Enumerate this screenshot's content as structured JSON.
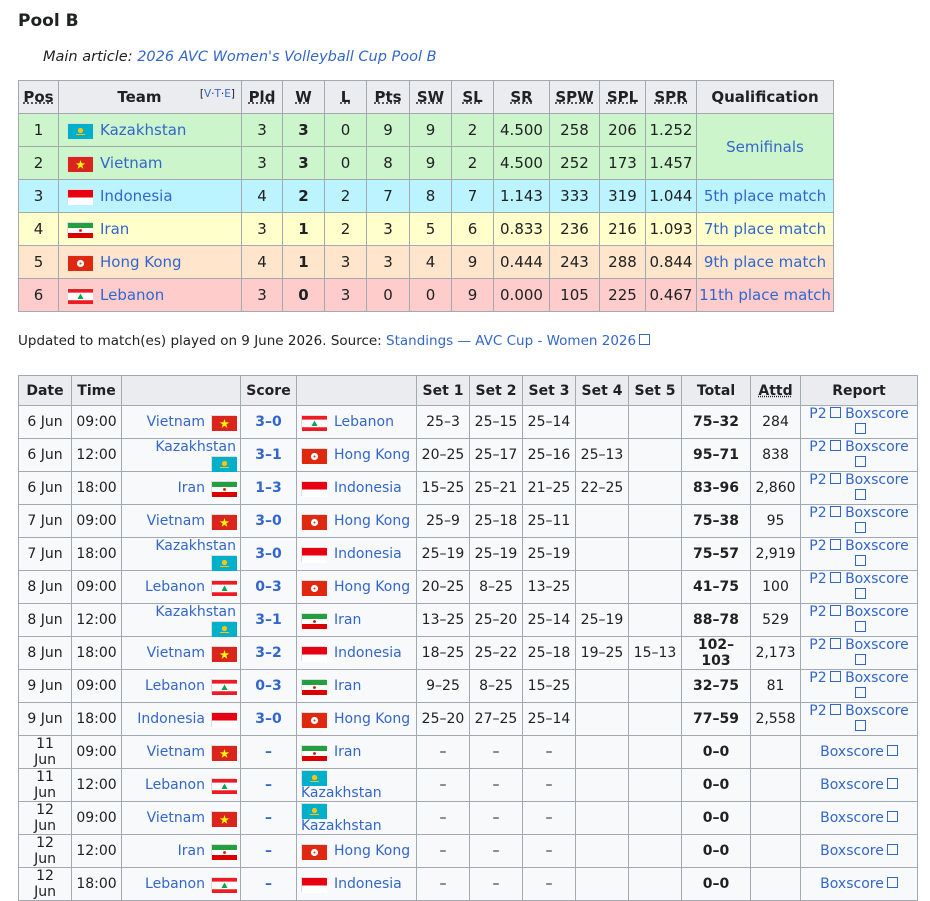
{
  "heading": "Pool B",
  "hatnote": {
    "prefix": "Main article: ",
    "link": "2026 AVC Women's Volleyball Cup Pool B"
  },
  "standings": {
    "headers": {
      "pos": "Pos",
      "team": "Team",
      "pld": "Pld",
      "w": "W",
      "l": "L",
      "pts": "Pts",
      "sw": "SW",
      "sl": "SL",
      "sr": "SR",
      "spw": "SPW",
      "spl": "SPL",
      "spr": "SPR",
      "qual": "Qualification"
    },
    "vte": {
      "v": "V",
      "t": "T",
      "e": "E"
    },
    "rows": [
      {
        "pos": "1",
        "team": "Kazakhstan",
        "flag": "kazakhstan-flag",
        "pld": "3",
        "w": "3",
        "l": "0",
        "pts": "9",
        "sw": "9",
        "sl": "2",
        "sr": "4.500",
        "spw": "258",
        "spl": "206",
        "spr": "1.252"
      },
      {
        "pos": "2",
        "team": "Vietnam",
        "flag": "vietnam-flag",
        "pld": "3",
        "w": "3",
        "l": "0",
        "pts": "8",
        "sw": "9",
        "sl": "2",
        "sr": "4.500",
        "spw": "252",
        "spl": "173",
        "spr": "1.457"
      },
      {
        "pos": "3",
        "team": "Indonesia",
        "flag": "indonesia-flag",
        "pld": "4",
        "w": "2",
        "l": "2",
        "pts": "7",
        "sw": "8",
        "sl": "7",
        "sr": "1.143",
        "spw": "333",
        "spl": "319",
        "spr": "1.044"
      },
      {
        "pos": "4",
        "team": "Iran",
        "flag": "iran-flag",
        "pld": "3",
        "w": "1",
        "l": "2",
        "pts": "3",
        "sw": "5",
        "sl": "6",
        "sr": "0.833",
        "spw": "236",
        "spl": "216",
        "spr": "1.093"
      },
      {
        "pos": "5",
        "team": "Hong Kong",
        "flag": "hong-kong-flag",
        "pld": "4",
        "w": "1",
        "l": "3",
        "pts": "3",
        "sw": "4",
        "sl": "9",
        "sr": "0.444",
        "spw": "243",
        "spl": "288",
        "spr": "0.844"
      },
      {
        "pos": "6",
        "team": "Lebanon",
        "flag": "lebanon-flag",
        "pld": "3",
        "w": "0",
        "l": "3",
        "pts": "0",
        "sw": "0",
        "sl": "9",
        "sr": "0.000",
        "spw": "105",
        "spl": "225",
        "spr": "0.467"
      }
    ],
    "qualification": [
      "Semifinals",
      "5th place match",
      "7th place match",
      "9th place match",
      "11th place match"
    ],
    "row_colors": [
      "#ccf5cc",
      "#bbf3ff",
      "#ffffcc",
      "#ffe5cc",
      "#ffcccc"
    ]
  },
  "updated": {
    "text": "Updated to match(es) played on 9 June 2026. Source: ",
    "source_link": "Standings — AVC Cup - Women 2026"
  },
  "matches": {
    "headers": {
      "date": "Date",
      "time": "Time",
      "score": "Score",
      "set1": "Set 1",
      "set2": "Set 2",
      "set3": "Set 3",
      "set4": "Set 4",
      "set5": "Set 5",
      "total": "Total",
      "attd": "Attd",
      "report": "Report"
    },
    "rows": [
      {
        "date": "6 Jun",
        "time": "09:00",
        "home": "Vietnam",
        "home_flag": "vietnam-flag",
        "score": "3–0",
        "away": "Lebanon",
        "away_flag": "lebanon-flag",
        "s1": "25–3",
        "s2": "25–15",
        "s3": "25–14",
        "s4": "",
        "s5": "",
        "total": "75–32",
        "attd": "284",
        "p2": "P2",
        "box": "Boxscore"
      },
      {
        "date": "6 Jun",
        "time": "12:00",
        "home": "Kazakhstan",
        "home_flag": "kazakhstan-flag",
        "score": "3–1",
        "away": "Hong Kong",
        "away_flag": "hong-kong-flag",
        "s1": "20–25",
        "s2": "25–17",
        "s3": "25–16",
        "s4": "25–13",
        "s5": "",
        "total": "95–71",
        "attd": "838",
        "p2": "P2",
        "box": "Boxscore"
      },
      {
        "date": "6 Jun",
        "time": "18:00",
        "home": "Iran",
        "home_flag": "iran-flag",
        "score": "1–3",
        "away": "Indonesia",
        "away_flag": "indonesia-flag",
        "s1": "15–25",
        "s2": "25–21",
        "s3": "21–25",
        "s4": "22–25",
        "s5": "",
        "total": "83–96",
        "attd": "2,860",
        "p2": "P2",
        "box": "Boxscore"
      },
      {
        "date": "7 Jun",
        "time": "09:00",
        "home": "Vietnam",
        "home_flag": "vietnam-flag",
        "score": "3–0",
        "away": "Hong Kong",
        "away_flag": "hong-kong-flag",
        "s1": "25–9",
        "s2": "25–18",
        "s3": "25–11",
        "s4": "",
        "s5": "",
        "total": "75–38",
        "attd": "95",
        "p2": "P2",
        "box": "Boxscore"
      },
      {
        "date": "7 Jun",
        "time": "18:00",
        "home": "Kazakhstan",
        "home_flag": "kazakhstan-flag",
        "score": "3–0",
        "away": "Indonesia",
        "away_flag": "indonesia-flag",
        "s1": "25–19",
        "s2": "25–19",
        "s3": "25–19",
        "s4": "",
        "s5": "",
        "total": "75–57",
        "attd": "2,919",
        "p2": "P2",
        "box": "Boxscore"
      },
      {
        "date": "8 Jun",
        "time": "09:00",
        "home": "Lebanon",
        "home_flag": "lebanon-flag",
        "score": "0–3",
        "away": "Hong Kong",
        "away_flag": "hong-kong-flag",
        "s1": "20–25",
        "s2": "8–25",
        "s3": "13–25",
        "s4": "",
        "s5": "",
        "total": "41–75",
        "attd": "100",
        "p2": "P2",
        "box": "Boxscore"
      },
      {
        "date": "8 Jun",
        "time": "12:00",
        "home": "Kazakhstan",
        "home_flag": "kazakhstan-flag",
        "score": "3–1",
        "away": "Iran",
        "away_flag": "iran-flag",
        "s1": "13–25",
        "s2": "25–20",
        "s3": "25–14",
        "s4": "25–19",
        "s5": "",
        "total": "88–78",
        "attd": "529",
        "p2": "P2",
        "box": "Boxscore"
      },
      {
        "date": "8 Jun",
        "time": "18:00",
        "home": "Vietnam",
        "home_flag": "vietnam-flag",
        "score": "3–2",
        "away": "Indonesia",
        "away_flag": "indonesia-flag",
        "s1": "18–25",
        "s2": "25–22",
        "s3": "25–18",
        "s4": "19–25",
        "s5": "15–13",
        "total": "102–103",
        "attd": "2,173",
        "p2": "P2",
        "box": "Boxscore"
      },
      {
        "date": "9 Jun",
        "time": "09:00",
        "home": "Lebanon",
        "home_flag": "lebanon-flag",
        "score": "0–3",
        "away": "Iran",
        "away_flag": "iran-flag",
        "s1": "9–25",
        "s2": "8–25",
        "s3": "15–25",
        "s4": "",
        "s5": "",
        "total": "32–75",
        "attd": "81",
        "p2": "P2",
        "box": "Boxscore"
      },
      {
        "date": "9 Jun",
        "time": "18:00",
        "home": "Indonesia",
        "home_flag": "indonesia-flag",
        "score": "3–0",
        "away": "Hong Kong",
        "away_flag": "hong-kong-flag",
        "s1": "25–20",
        "s2": "27–25",
        "s3": "25–14",
        "s4": "",
        "s5": "",
        "total": "77–59",
        "attd": "2,558",
        "p2": "P2",
        "box": "Boxscore"
      },
      {
        "date": "11 Jun",
        "time": "09:00",
        "home": "Vietnam",
        "home_flag": "vietnam-flag",
        "score": "–",
        "away": "Iran",
        "away_flag": "iran-flag",
        "s1": "–",
        "s2": "–",
        "s3": "–",
        "s4": "",
        "s5": "",
        "total": "0–0",
        "attd": "",
        "p2": "",
        "box": "Boxscore"
      },
      {
        "date": "11 Jun",
        "time": "12:00",
        "home": "Lebanon",
        "home_flag": "lebanon-flag",
        "score": "–",
        "away": "Kazakhstan",
        "away_flag": "kazakhstan-flag",
        "s1": "–",
        "s2": "–",
        "s3": "–",
        "s4": "",
        "s5": "",
        "total": "0–0",
        "attd": "",
        "p2": "",
        "box": "Boxscore"
      },
      {
        "date": "12 Jun",
        "time": "09:00",
        "home": "Vietnam",
        "home_flag": "vietnam-flag",
        "score": "–",
        "away": "Kazakhstan",
        "away_flag": "kazakhstan-flag",
        "s1": "–",
        "s2": "–",
        "s3": "–",
        "s4": "",
        "s5": "",
        "total": "0–0",
        "attd": "",
        "p2": "",
        "box": "Boxscore"
      },
      {
        "date": "12 Jun",
        "time": "12:00",
        "home": "Iran",
        "home_flag": "iran-flag",
        "score": "–",
        "away": "Hong Kong",
        "away_flag": "hong-kong-flag",
        "s1": "–",
        "s2": "–",
        "s3": "–",
        "s4": "",
        "s5": "",
        "total": "0–0",
        "attd": "",
        "p2": "",
        "box": "Boxscore"
      },
      {
        "date": "12 Jun",
        "time": "18:00",
        "home": "Lebanon",
        "home_flag": "lebanon-flag",
        "score": "–",
        "away": "Indonesia",
        "away_flag": "indonesia-flag",
        "s1": "–",
        "s2": "–",
        "s3": "–",
        "s4": "",
        "s5": "",
        "total": "0–0",
        "attd": "",
        "p2": "",
        "box": "Boxscore"
      }
    ]
  }
}
